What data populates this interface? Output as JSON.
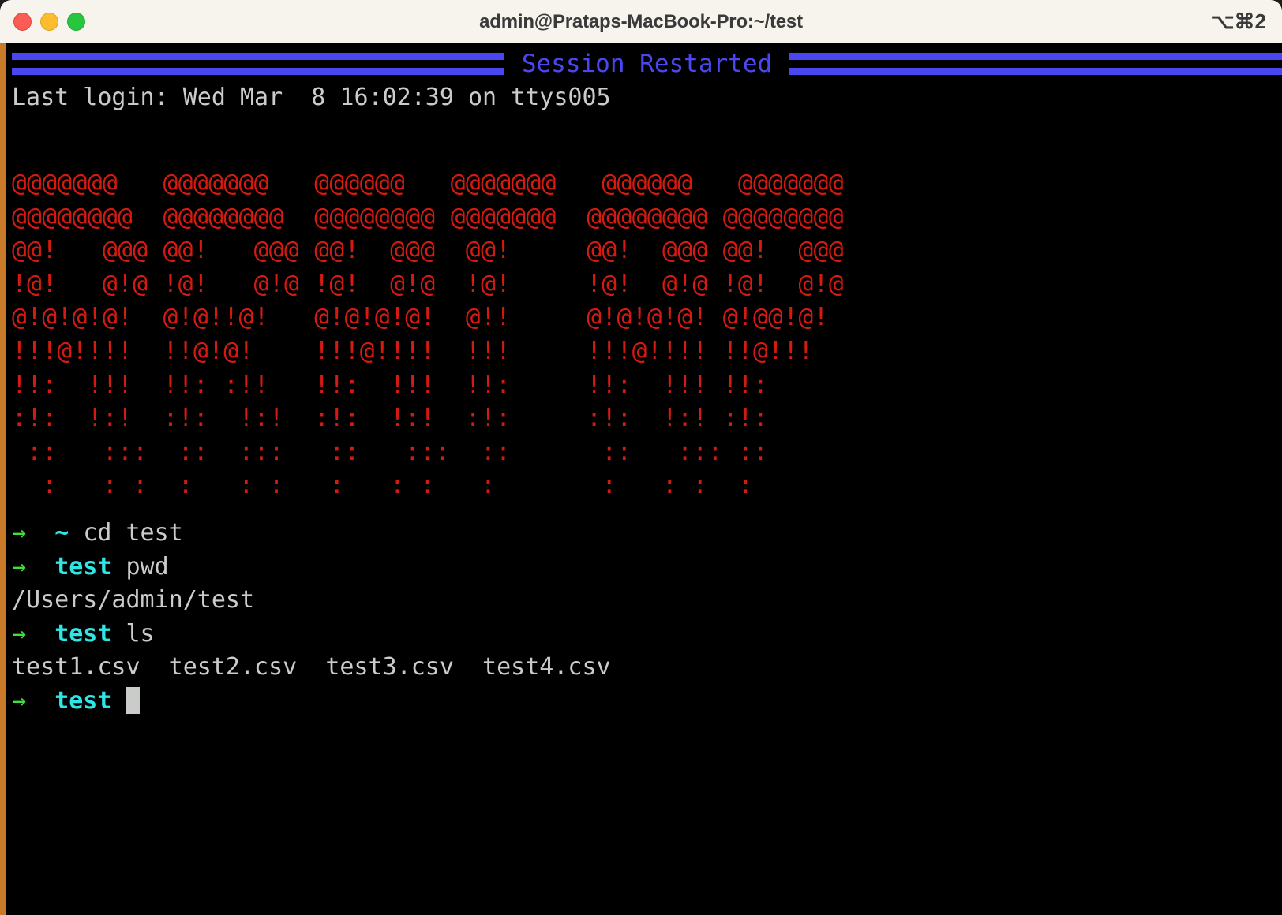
{
  "window": {
    "title": "admin@Prataps-MacBook-Pro:~/test",
    "shortcut": "⌥⌘2",
    "traffic_lights": [
      "close",
      "minimize",
      "zoom"
    ],
    "colors": {
      "titlebar_bg": "#f7f4ee",
      "terminal_bg": "#000000",
      "close": "#fb5c54",
      "minimize": "#fdbc2e",
      "zoom": "#26c63f",
      "left_border": "#c87a28"
    }
  },
  "terminal": {
    "banner": {
      "text": "Session Restarted",
      "color": "#4a47f0"
    },
    "login_line": "Last login: Wed Mar  8 16:02:39 on ttys005",
    "ascii_art": {
      "color": "#d51a10",
      "lines": [
        "@@@@@@@   @@@@@@@   @@@@@@   @@@@@@@   @@@@@@   @@@@@@@",
        "@@@@@@@@  @@@@@@@@  @@@@@@@@ @@@@@@@  @@@@@@@@ @@@@@@@@",
        "@@!   @@@ @@!   @@@ @@!  @@@  @@!     @@!  @@@ @@!  @@@",
        "!@!   @!@ !@!   @!@ !@!  @!@  !@!     !@!  @!@ !@!  @!@",
        "@!@!@!@!  @!@!!@!   @!@!@!@!  @!!     @!@!@!@! @!@@!@!",
        "!!!@!!!!  !!@!@!    !!!@!!!!  !!!     !!!@!!!! !!@!!!",
        "!!:  !!!  !!: :!!   !!:  !!!  !!:     !!:  !!! !!:",
        ":!:  !:!  :!:  !:!  :!:  !:!  :!:     :!:  !:! :!:",
        " ::   :::  ::  :::   ::   :::  ::      ::   ::: ::",
        "  :   : :  :   : :   :   : :   :       :   : :  :"
      ]
    },
    "session": [
      {
        "type": "prompt",
        "arrow": "→",
        "cwd": "~",
        "command": "cd test"
      },
      {
        "type": "prompt",
        "arrow": "→",
        "cwd": "test",
        "command": "pwd"
      },
      {
        "type": "output",
        "text": "/Users/admin/test"
      },
      {
        "type": "prompt",
        "arrow": "→",
        "cwd": "test",
        "command": "ls"
      },
      {
        "type": "output",
        "text": "test1.csv  test2.csv  test3.csv  test4.csv"
      },
      {
        "type": "prompt",
        "arrow": "→",
        "cwd": "test",
        "command": "",
        "cursor": true
      }
    ],
    "files": [
      "test1.csv",
      "test2.csv",
      "test3.csv",
      "test4.csv"
    ],
    "prompt_colors": {
      "arrow": "#3ee03e",
      "cwd": "#2ee6e6",
      "text": "#c9ccc9"
    }
  }
}
